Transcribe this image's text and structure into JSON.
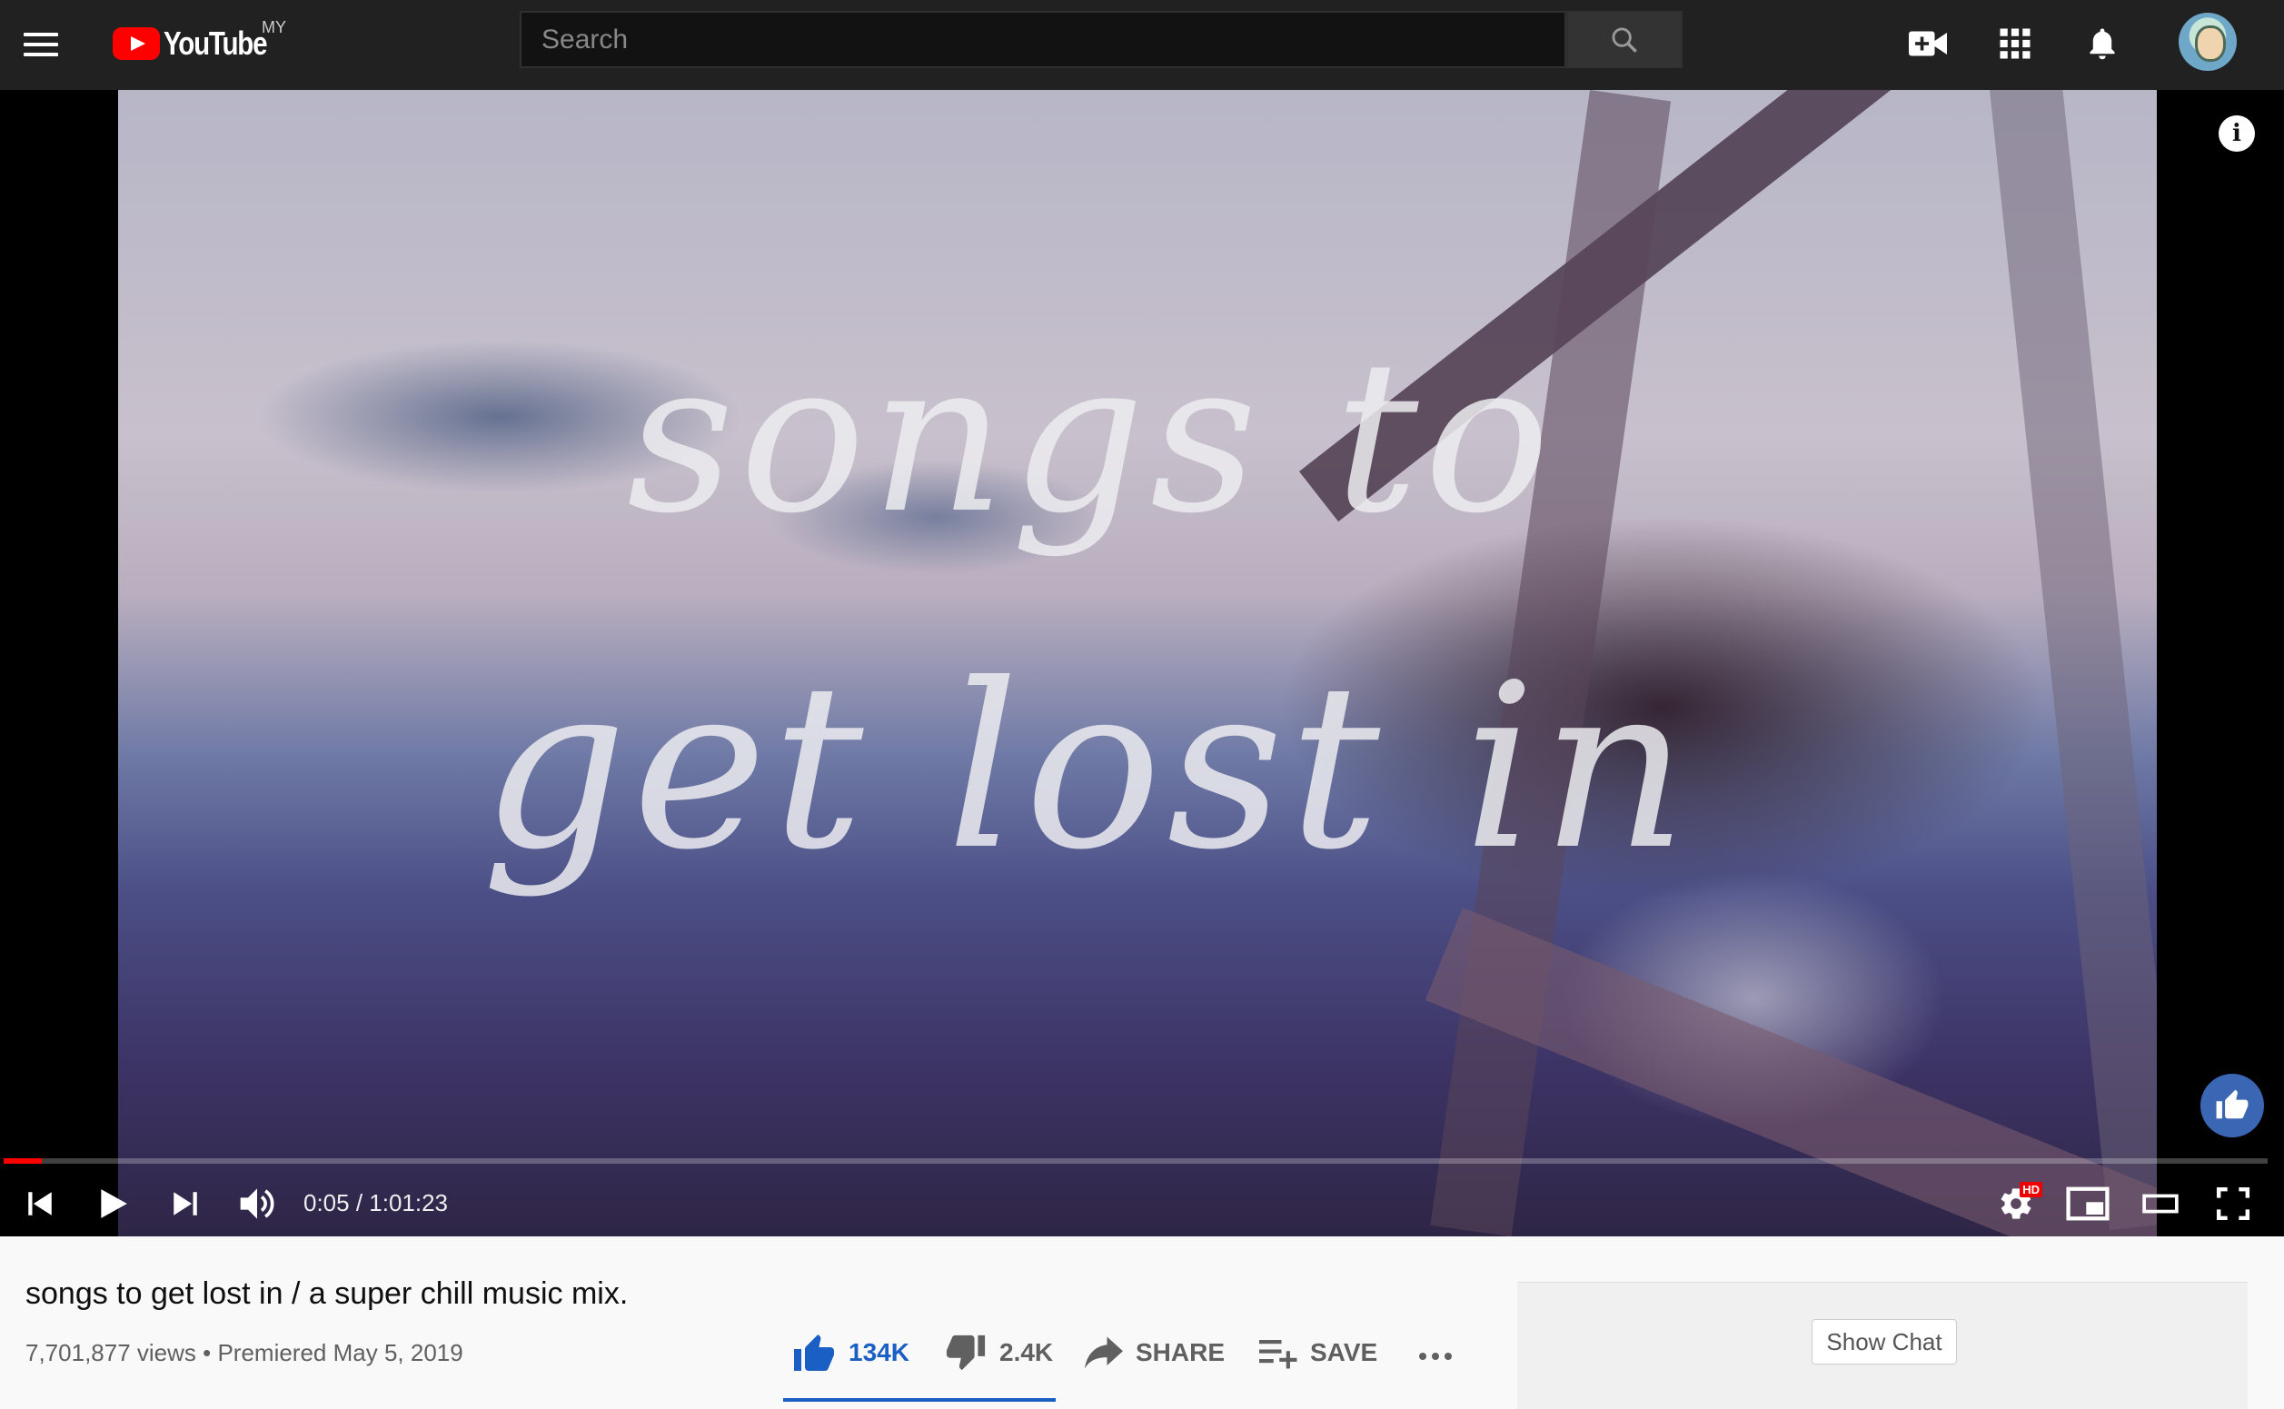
{
  "masthead": {
    "logo_text": "YouTube",
    "region": "MY",
    "search_placeholder": "Search"
  },
  "player": {
    "overlay_line1": "songs to",
    "overlay_line2": "get lost in",
    "info_glyph": "i",
    "time": "0:05 / 1:01:23",
    "played_fraction": 0.017,
    "loaded_fraction": 0.017,
    "settings_badge": "HD"
  },
  "video": {
    "title": "songs to get lost in / a super chill music mix.",
    "meta": "7,701,877 views • Premiered May 5, 2019"
  },
  "actions": {
    "like_count": "134K",
    "dislike_count": "2.4K",
    "share_label": "SHARE",
    "save_label": "SAVE"
  },
  "chat": {
    "show_chat_label": "Show Chat"
  },
  "colors": {
    "accent_red": "#ff0000",
    "like_blue": "#1a5fc4",
    "masthead_bg": "#212121"
  }
}
